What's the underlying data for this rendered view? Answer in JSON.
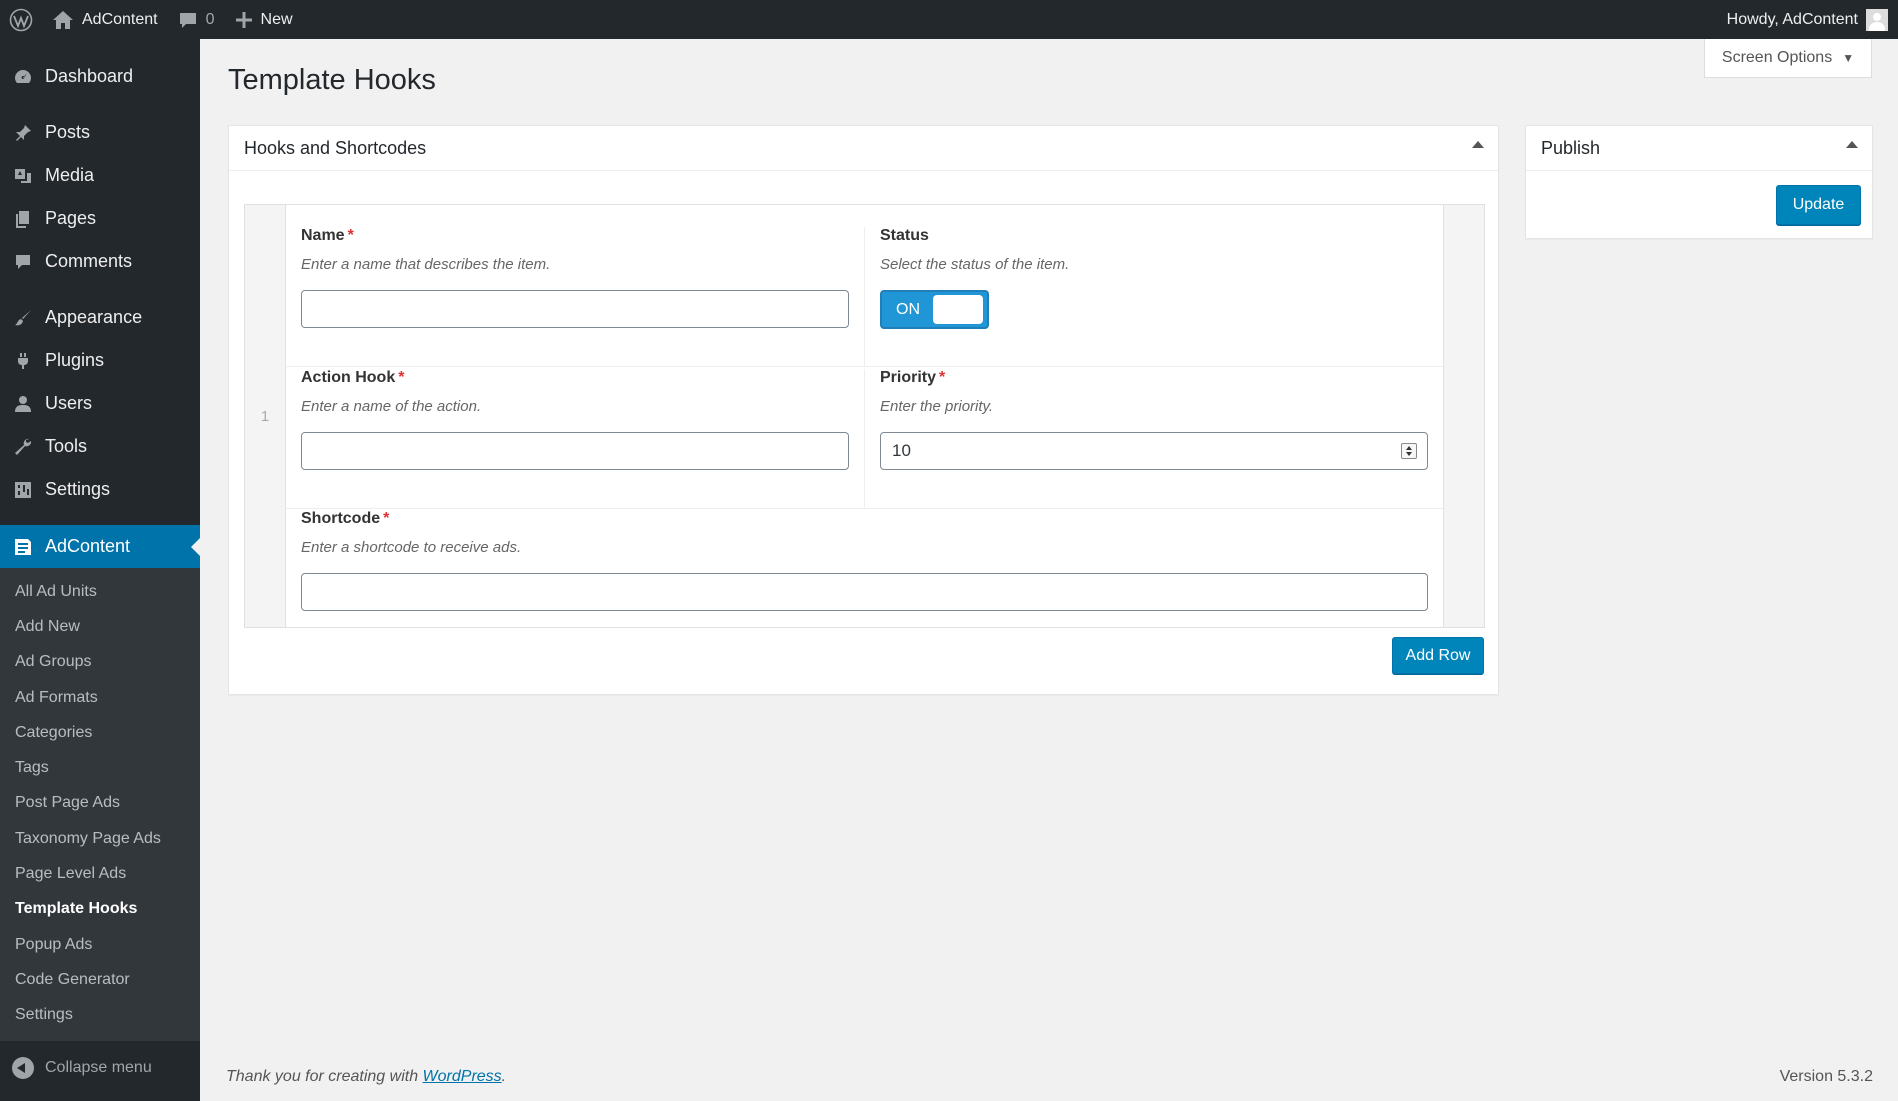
{
  "admin_bar": {
    "site_name": "AdContent",
    "comments_count": "0",
    "new_label": "New",
    "greeting": "Howdy, AdContent"
  },
  "sidebar": {
    "items": [
      {
        "label": "Dashboard",
        "icon": "dashboard-icon"
      },
      {
        "label": "Posts",
        "icon": "pin-icon"
      },
      {
        "label": "Media",
        "icon": "media-icon"
      },
      {
        "label": "Pages",
        "icon": "pages-icon"
      },
      {
        "label": "Comments",
        "icon": "comment-icon"
      },
      {
        "label": "Appearance",
        "icon": "brush-icon"
      },
      {
        "label": "Plugins",
        "icon": "plug-icon"
      },
      {
        "label": "Users",
        "icon": "user-icon"
      },
      {
        "label": "Tools",
        "icon": "wrench-icon"
      },
      {
        "label": "Settings",
        "icon": "settings-icon"
      },
      {
        "label": "AdContent",
        "icon": "document-icon"
      }
    ],
    "submenu": [
      "All Ad Units",
      "Add New",
      "Ad Groups",
      "Ad Formats",
      "Categories",
      "Tags",
      "Post Page Ads",
      "Taxonomy Page Ads",
      "Page Level Ads",
      "Template Hooks",
      "Popup Ads",
      "Code Generator",
      "Settings"
    ],
    "active_submenu": "Template Hooks",
    "collapse_label": "Collapse menu"
  },
  "screen_options_label": "Screen Options",
  "page_title": "Template Hooks",
  "hooks_box": {
    "title": "Hooks and Shortcodes",
    "row_number": "1",
    "fields": {
      "name": {
        "label": "Name",
        "required": "*",
        "description": "Enter a name that describes the item.",
        "value": ""
      },
      "status": {
        "label": "Status",
        "description": "Select the status of the item.",
        "value": "ON"
      },
      "action_hook": {
        "label": "Action Hook",
        "required": "*",
        "description": "Enter a name of the action.",
        "value": ""
      },
      "priority": {
        "label": "Priority",
        "required": "*",
        "description": "Enter the priority.",
        "value": "10"
      },
      "shortcode": {
        "label": "Shortcode",
        "required": "*",
        "description": "Enter a shortcode to receive ads.",
        "value": ""
      }
    },
    "add_row_label": "Add Row"
  },
  "publish_box": {
    "title": "Publish",
    "update_label": "Update"
  },
  "footer": {
    "thanks_prefix": "Thank you for creating with ",
    "thanks_link": "WordPress",
    "thanks_suffix": ".",
    "version": "Version 5.3.2"
  },
  "colors": {
    "admin_bg": "#23282d",
    "accent": "#0073aa",
    "button": "#0085ba",
    "required": "#dc3232",
    "toggle_on": "#2196d6"
  }
}
